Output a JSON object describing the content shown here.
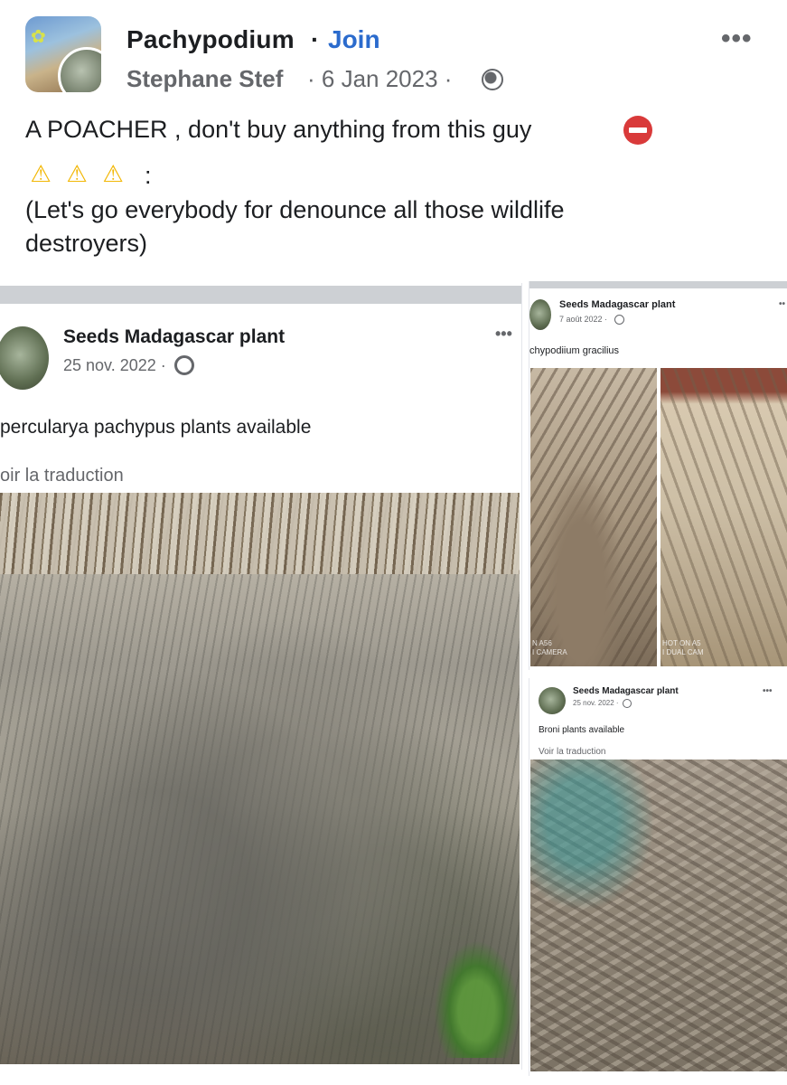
{
  "header": {
    "group_name": "Pachypodium",
    "separator": "·",
    "join_label": "Join",
    "more_label": "•••",
    "author": "Stephane Stef",
    "date_meta": "· 6 Jan 2023 ·",
    "privacy_icon": "globe-icon"
  },
  "post": {
    "line1": "A POACHER , don't buy anything from this guy",
    "line2_suffix": ":",
    "line3": "(Let's go everybody for denounce all those wildlife",
    "line4": "destroyers)",
    "emoji_no_entry": "no-entry-icon",
    "emoji_warning": "warning-icon",
    "warning_glyph": "⚠"
  },
  "screenshots": {
    "left": {
      "page_name": "Seeds Madagascar plant",
      "date": "25 nov. 2022 ·",
      "text": "percularya pachypus plants available",
      "translate": "oir la traduction",
      "more": "•••"
    },
    "right_top": {
      "page_name": "Seeds Madagascar plant",
      "date": "7 août 2022 ·",
      "text": "chypodiium gracilius",
      "more": "••",
      "watermark": "N A56\nI CAMERA",
      "watermark2": "HOT ON A5\nI DUAL CAM"
    },
    "right_bottom": {
      "page_name": "Seeds Madagascar plant",
      "date": "25 nov. 2022 ·",
      "text": "Broni plants available",
      "translate": "Voir la traduction",
      "more": "•••"
    }
  },
  "colors": {
    "accent": "#2b6bcd",
    "muted": "#65676b",
    "text": "#1c1e21",
    "alert": "#d93a3a",
    "warning": "#f2b705"
  }
}
